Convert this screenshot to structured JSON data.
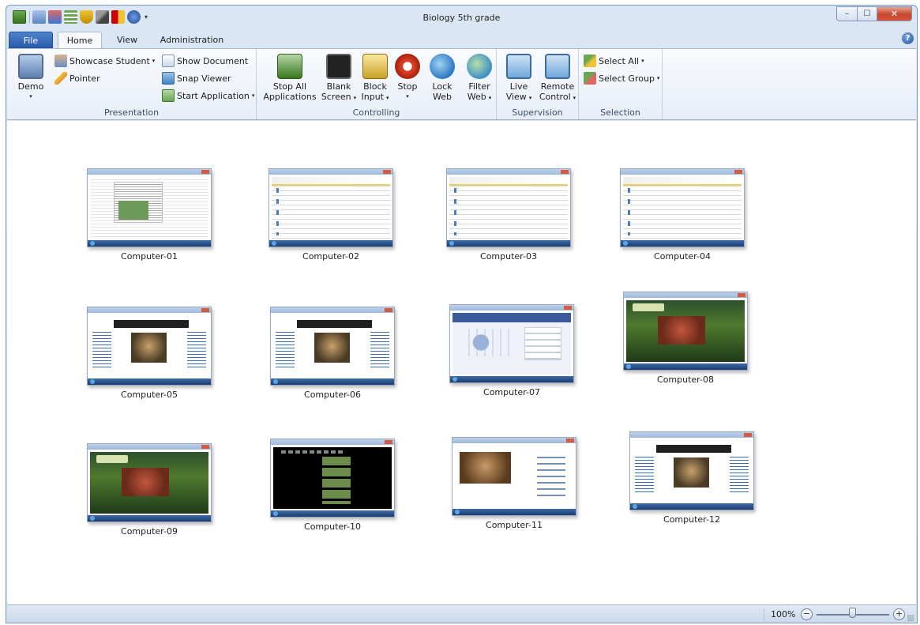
{
  "window": {
    "title": "Biology 5th grade",
    "minimize": "–",
    "maximize": "☐",
    "close": "✕"
  },
  "tabs": {
    "file": "File",
    "home": "Home",
    "view": "View",
    "administration": "Administration",
    "help": "?"
  },
  "ribbon": {
    "presentation": {
      "label": "Presentation",
      "demo": "Demo",
      "showcase_student": "Showcase Student",
      "pointer": "Pointer",
      "show_document": "Show Document",
      "snap_viewer": "Snap Viewer",
      "start_application": "Start Application"
    },
    "controlling": {
      "label": "Controlling",
      "stop_all_1": "Stop All",
      "stop_all_2": "Applications",
      "blank_1": "Blank",
      "blank_2": "Screen",
      "block_1": "Block",
      "block_2": "Input",
      "stop": "Stop",
      "lock_1": "Lock",
      "lock_2": "Web",
      "filter_1": "Filter",
      "filter_2": "Web"
    },
    "supervision": {
      "label": "Supervision",
      "live_1": "Live",
      "live_2": "View",
      "remote_1": "Remote",
      "remote_2": "Control"
    },
    "selection": {
      "label": "Selection",
      "select_all": "Select All",
      "select_group": "Select Group"
    }
  },
  "computers": [
    {
      "name": "Computer-01",
      "screen": "doc"
    },
    {
      "name": "Computer-02",
      "screen": "sheet"
    },
    {
      "name": "Computer-03",
      "screen": "sheet"
    },
    {
      "name": "Computer-04",
      "screen": "sheet"
    },
    {
      "name": "Computer-05",
      "screen": "web"
    },
    {
      "name": "Computer-06",
      "screen": "web"
    },
    {
      "name": "Computer-07",
      "screen": "fb"
    },
    {
      "name": "Computer-08",
      "screen": "nat"
    },
    {
      "name": "Computer-09",
      "screen": "nat"
    },
    {
      "name": "Computer-10",
      "screen": "dark"
    },
    {
      "name": "Computer-11",
      "screen": "yt"
    },
    {
      "name": "Computer-12",
      "screen": "web"
    }
  ],
  "status": {
    "zoom": "100%",
    "zoom_out": "−",
    "zoom_in": "+",
    "zoom_slider_fraction": 0.5
  }
}
